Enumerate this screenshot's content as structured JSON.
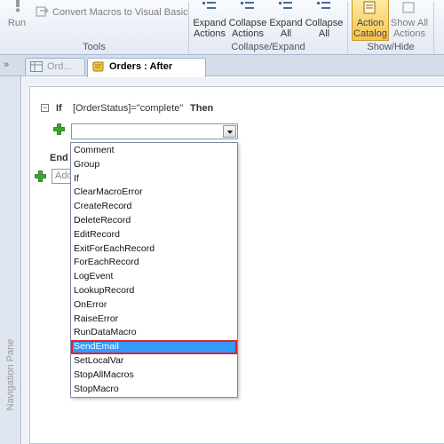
{
  "ribbon": {
    "run_label": "Run",
    "convert_label": "Convert Macros to Visual Basic",
    "tools_group": "Tools",
    "expand_actions": [
      "Expand",
      "Actions"
    ],
    "collapse_actions": [
      "Collapse",
      "Actions"
    ],
    "expand_all": [
      "Expand",
      "All"
    ],
    "collapse_all": [
      "Collapse",
      "All"
    ],
    "collapse_expand_group": "Collapse/Expand",
    "action_catalog": [
      "Action",
      "Catalog"
    ],
    "show_all_actions": [
      "Show All",
      "Actions"
    ],
    "show_hide_group": "Show/Hide"
  },
  "tabs": {
    "inactive_label": "Ord...",
    "active_label": "Orders : After Update :"
  },
  "nav_pane": {
    "label": "Navigation Pane",
    "chevron": "»"
  },
  "macro": {
    "if_keyword": "If",
    "condition": "[OrderStatus]=\"complete\"",
    "then_keyword": "Then",
    "end_if_label": "End If",
    "add_new_action_placeholder": "Add New Action",
    "collapse_symbol": "−"
  },
  "dropdown": {
    "selected": "SendEmail",
    "items": [
      "Comment",
      "Group",
      "If",
      "ClearMacroError",
      "CreateRecord",
      "DeleteRecord",
      "EditRecord",
      "ExitForEachRecord",
      "ForEachRecord",
      "LogEvent",
      "LookupRecord",
      "OnError",
      "RaiseError",
      "RunDataMacro",
      "SendEmail",
      "SetLocalVar",
      "StopAllMacros",
      "StopMacro"
    ]
  },
  "colors": {
    "selection_highlight": "#3399ff",
    "selection_outline": "#e1222a",
    "active_button": "#f7c54c",
    "add_icon": "#3aa82c"
  }
}
